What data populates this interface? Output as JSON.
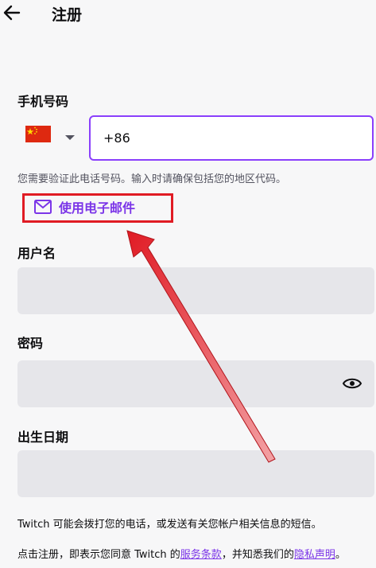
{
  "header": {
    "title": "注册"
  },
  "phone": {
    "label": "手机号码",
    "value": "+86",
    "hint": "您需要验证此电话号码。输入时请确保包括您的地区代码。"
  },
  "email_link": {
    "label": "使用电子邮件"
  },
  "username": {
    "label": "用户名"
  },
  "password": {
    "label": "密码"
  },
  "birthdate": {
    "label": "出生日期"
  },
  "footer": {
    "sms_notice": "Twitch 可能会拨打您的电话，或发送有关您帐户相关信息的短信。",
    "terms_prefix": "点击注册，即表示您同意 Twitch 的",
    "terms_link": "服务条款",
    "terms_middle": "，并知悉我们的",
    "privacy_link": "隐私声明",
    "terms_suffix": "。"
  },
  "colors": {
    "accent": "#8a3ffc",
    "link": "#7b35e8",
    "highlight": "#e01b24",
    "field_bg": "#e6e6ea"
  },
  "icons": [
    "back-arrow-icon",
    "china-flag-icon",
    "chevron-down-icon",
    "mail-icon",
    "eye-icon"
  ]
}
